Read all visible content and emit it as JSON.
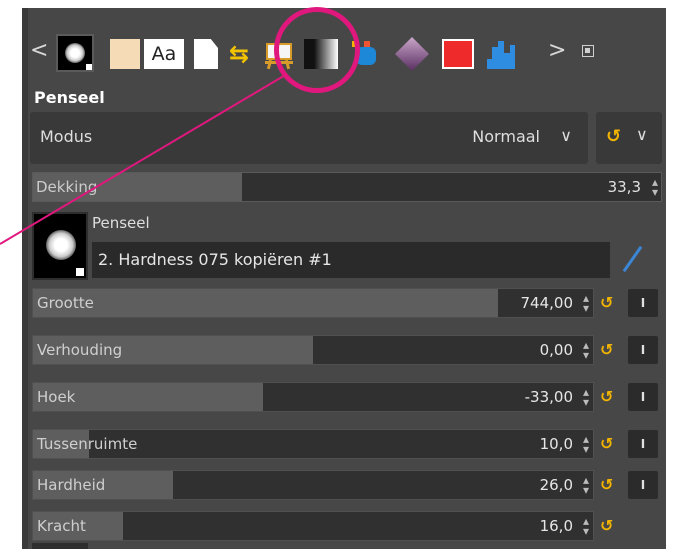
{
  "tabs": {
    "prev": "<",
    "next": ">",
    "font_label": "Aa",
    "items": [
      "brush-tab",
      "pattern-tab",
      "font-tab",
      "document-tab",
      "undo-history-tab",
      "tool-options-tab",
      "gradient-tab",
      "palette-tab",
      "dynamics-tab",
      "color-tab",
      "histogram-tab"
    ],
    "highlight_color": "#e0187e"
  },
  "panel": {
    "title": "Penseel",
    "mode": {
      "label": "Modus",
      "value": "Normaal"
    },
    "opacity": {
      "label": "Dekking",
      "value": "33,3",
      "fraction": 0.333
    },
    "brush": {
      "caption": "Penseel",
      "name": "2. Hardness 075 kopiëren #1"
    },
    "sliders": [
      {
        "label": "Grootte",
        "value": "744,00",
        "fill": 0.83
      },
      {
        "label": "Verhouding",
        "value": "0,00",
        "fill": 0.5
      },
      {
        "label": "Hoek",
        "value": "-33,00",
        "fill": 0.41
      },
      {
        "label": "Tussenruimte",
        "value": "10,0",
        "fill": 0.1
      },
      {
        "label": "Hardheid",
        "value": "26,0",
        "fill": 0.25
      },
      {
        "label": "Kracht",
        "value": "16,0",
        "fill": 0.16
      }
    ]
  },
  "colors": {
    "accent": "#f2b400",
    "panel": "#474747",
    "link": "#3b86d6"
  }
}
